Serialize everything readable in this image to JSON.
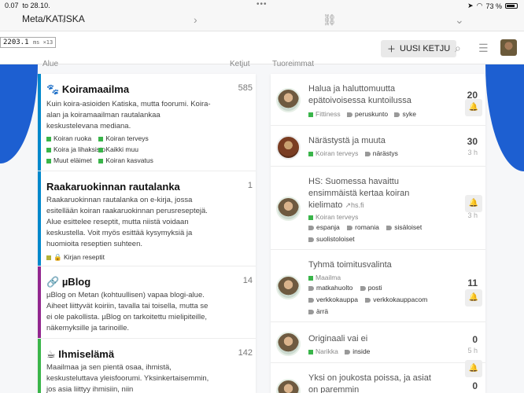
{
  "status": {
    "time": "0.07",
    "date": "to 28.10.",
    "battery": "73 %"
  },
  "perf": {
    "value": "2203.1",
    "unit": "ms ×13"
  },
  "header": {
    "site_title": "Meta/KATISKA",
    "new_topic_label": "UUSI KETJU"
  },
  "columns": {
    "categories": "Alue",
    "topics": "Ketjut",
    "latest": "Tuoreimmat"
  },
  "categories": [
    {
      "name": "Koiramaailma",
      "count": "585",
      "color": "#0088cc",
      "description": "Kuin koira-asioiden Katiska, mutta foorumi. Koira-alan ja koiramaailman rautalankaa keskustelevana mediana.",
      "subcategories": [
        "Koiran ruoka",
        "Koiran terveys",
        "Koira ja lihaksisto",
        "Kaikki muu",
        "Muut eläimet",
        "Koiran kasvatus"
      ]
    },
    {
      "name": "Raakaruokinnan rautalanka",
      "count": "1",
      "color": "#0088cc",
      "description": "Raakaruokinnan rautalanka on e-kirja, jossa esitellään koiran raakaruokinnan perusreseptejä. Alue esittelee reseptit, mutta niistä voidaan keskustella. Voit myös esittää kysymyksiä ja huomioita reseptien suhteen.",
      "subcategories": [
        "Kirjan reseptit"
      ]
    },
    {
      "name": "µBlog",
      "count": "14",
      "color": "#92278f",
      "description": "µBlog on Metan (kohtuullisen) vapaa blogi-alue. Aiheet liittyvät koiriin, tavalla tai toisella, mutta se ei ole pakollista. µBlog on tarkoitettu mielipiteille, näkemyksille ja tarinoille."
    },
    {
      "name": "Ihmiselämä",
      "count": "142",
      "color": "#3ab54a",
      "description": "Maailmaa ja sen pientä osaa, ihmistä, keskusteluttava yleisfoorumi. Yksinkertaisemmin, jos asia liittyy ihmisiin, niin"
    }
  ],
  "topics": [
    {
      "title": "Halua ja haluttomuutta epätoivoisessa kuntoilussa",
      "category": "Fittiness",
      "category_color": "#3ab54a",
      "tags": [
        "peruskunto",
        "syke"
      ],
      "count": "20",
      "age": ""
    },
    {
      "title": "Närästystä ja muuta",
      "category": "Koiran terveys",
      "category_color": "#3ab54a",
      "tags": [
        "närästys"
      ],
      "count": "30",
      "age": "3 h"
    },
    {
      "title": "HS: Suomessa havaittu ensimmäistä kertaa koiran kielimato",
      "domain": "hs.fi",
      "category": "Koiran terveys",
      "category_color": "#3ab54a",
      "tags": [
        "espanja",
        "romania",
        "sisäloiset",
        "suolistoloiset"
      ],
      "count": "",
      "age": "3 h"
    },
    {
      "title": "Tyhmä toimitusvalinta",
      "category": "Maailma",
      "category_color": "#3ab54a",
      "tags": [
        "matkahuolto",
        "posti",
        "verkkokauppa",
        "verkkokauppacom",
        "ärrä"
      ],
      "count": "11",
      "age": ""
    },
    {
      "title": "Originaali vai ei",
      "category": "Narikka",
      "category_color": "#3ab54a",
      "tags": [
        "inside"
      ],
      "count": "0",
      "age": "5 h"
    },
    {
      "title": "Yksi on joukosta poissa, ja asiat on paremmin",
      "category": "",
      "category_color": "#3ab54a",
      "tags": [],
      "count": "0",
      "age": ""
    }
  ]
}
